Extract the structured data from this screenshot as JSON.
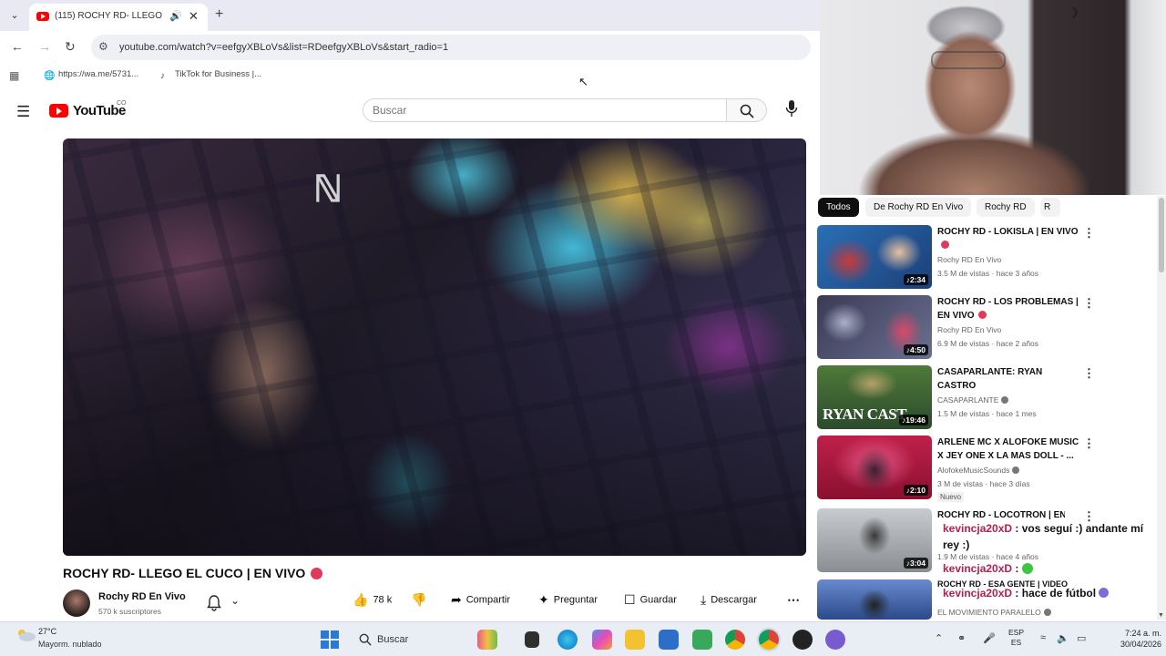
{
  "browser": {
    "tab_title": "(115) ROCHY RD- LLEGO E",
    "url": "youtube.com/watch?v=eefgyXBLoVs&list=RDeefgyXBLoVs&start_radio=1",
    "bookmarks": [
      {
        "label": "https://wa.me/5731..."
      },
      {
        "label": "TikTok for Business |..."
      }
    ]
  },
  "youtube": {
    "wordmark": "YouTube",
    "country_code": "CO",
    "search_placeholder": "Buscar",
    "video_title": "ROCHY RD- LLEGO EL CUCO | EN VIVO",
    "channel_name": "Rochy RD En Vivo",
    "channel_subscribers": "570 k suscriptores",
    "like_count": "78 k",
    "actions": {
      "share": "Compartir",
      "ask": "Preguntar",
      "save": "Guardar",
      "download": "Descargar"
    },
    "chips": [
      "Todos",
      "De Rochy RD En Vivo",
      "Rochy RD",
      "R"
    ],
    "recommendations": [
      {
        "title": "ROCHY RD - LOKISLA | EN VIVO",
        "channel": "Rochy RD En Vivo",
        "meta": "3.5 M de vistas · hace 3 años",
        "duration": "2:34",
        "colors": [
          "#2a6fb5",
          "#c83a3a",
          "#e8c0a0"
        ]
      },
      {
        "title": "ROCHY RD - LOS PROBLEMAS | EN VIVO",
        "channel": "Rochy RD En Vivo",
        "meta": "6.9 M de vistas · hace 2 años",
        "duration": "4:50",
        "colors": [
          "#3a3a55",
          "#d94a6a",
          "#aab0c8"
        ]
      },
      {
        "title": "CASAPARLANTE: RYAN CASTRO",
        "channel": "CASAPARLANTE",
        "meta": "1.5 M de vistas · hace 1 mes",
        "duration": "19:46",
        "thumb_text": "RYAN CAST",
        "colors": [
          "#2c4a2c",
          "#4e7a3a",
          "#b6a06a"
        ]
      },
      {
        "title": "ARLENE MC X ALOFOKE MUSIC X JEY ONE X LA MAS DOLL - ...",
        "channel": "AlofokeMusicSounds",
        "meta": "3 M de vistas · hace 3 días",
        "badge": "Nuevo",
        "duration": "2:10",
        "colors": [
          "#c0204a",
          "#e85a8a",
          "#3a2030"
        ]
      },
      {
        "title": "ROCHY RD - LOCOTRON | EN",
        "channel": "",
        "meta": "1.9 M de vistas · hace 4 años",
        "duration": "3:04",
        "colors": [
          "#8a8e92",
          "#c8ccd0",
          "#3a3a3a"
        ]
      },
      {
        "title": "ROCHY RD - ESA GENTE | VIDEO",
        "channel": "EL MOVIMIENTO PARALELO",
        "meta": "",
        "duration": "",
        "colors": [
          "#2a4a8a",
          "#6a8ad0",
          "#222"
        ]
      }
    ]
  },
  "chat": [
    {
      "user": "kevincja20xD",
      "message": ": vos seguí :) andante mí rey :)"
    },
    {
      "user": "kevincja20xD",
      "message": ":"
    },
    {
      "user": "kevincja20xD",
      "message": ": hace de fútbol"
    }
  ],
  "taskbar": {
    "weather_temp": "27°C",
    "weather_desc": "Mayorm. nublado",
    "search_label": "Buscar",
    "lang_top": "ESP",
    "lang_bottom": "ES",
    "time": "7:24 a. m.",
    "date": "30/04/2026"
  },
  "colors": {
    "youtube_red": "#ff0000",
    "chat_user": "#b81e4a",
    "live_dot": "#e03a5a"
  }
}
